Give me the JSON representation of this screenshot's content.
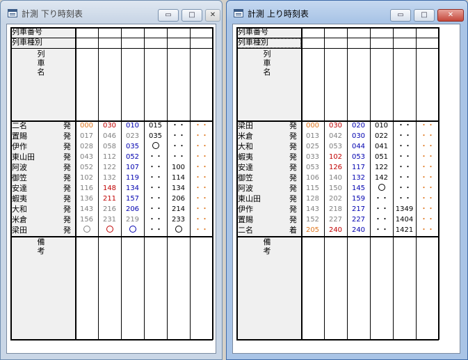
{
  "windows": [
    {
      "id": "down",
      "title": "計測 下り時刻表",
      "controls": {
        "minimize": "▭",
        "maximize": "□",
        "close": "✕"
      },
      "headers": {
        "train_number": "列車番号",
        "train_type": "列車種別",
        "train_name": "列車名",
        "remarks": "備考"
      },
      "stations": [
        {
          "name": "二名",
          "kind": "発"
        },
        {
          "name": "置賜",
          "kind": "発"
        },
        {
          "name": "伊作",
          "kind": "発"
        },
        {
          "name": "東山田",
          "kind": "発"
        },
        {
          "name": "阿波",
          "kind": "発"
        },
        {
          "name": "御笠",
          "kind": "発"
        },
        {
          "name": "安達",
          "kind": "発"
        },
        {
          "name": "蝦夷",
          "kind": "発"
        },
        {
          "name": "大和",
          "kind": "発"
        },
        {
          "name": "米倉",
          "kind": "発"
        },
        {
          "name": "梁田",
          "kind": "発"
        }
      ],
      "columns": [
        {
          "color": "#808080",
          "times": [
            "000",
            "017",
            "028",
            "043",
            "052",
            "102",
            "116",
            "136",
            "143",
            "156",
            "○"
          ],
          "first_color": "#e07820"
        },
        {
          "color": "#808080",
          "times": [
            "030",
            "046",
            "058",
            "112",
            "122",
            "132",
            "148",
            "211",
            "216",
            "231",
            "○"
          ],
          "first_color": "#c00000",
          "red_rows": [
            0,
            6,
            7,
            10
          ]
        },
        {
          "color": "#0000b0",
          "times": [
            "010",
            "023",
            "035",
            "052",
            "107",
            "119",
            "134",
            "157",
            "206",
            "219",
            "○"
          ],
          "gray_rows": [
            1,
            9
          ]
        },
        {
          "color": "#000000",
          "times": [
            "015",
            "035",
            "○",
            "・・",
            "・・",
            "・・",
            "・・",
            "・・",
            "・・",
            "・・",
            "・・"
          ]
        },
        {
          "color": "#000000",
          "times": [
            "・・",
            "・・",
            "・・",
            "・・",
            "100",
            "114",
            "134",
            "206",
            "214",
            "233",
            "○"
          ]
        },
        {
          "color": "#e07820",
          "times": [
            "・・",
            "・・",
            "・・",
            "・・",
            "・・",
            "・・",
            "・・",
            "・・",
            "・・",
            "・・",
            "・・"
          ]
        }
      ]
    },
    {
      "id": "up",
      "title": "計測 上り時刻表",
      "controls": {
        "minimize": "▭",
        "maximize": "□",
        "close": "✕"
      },
      "headers": {
        "train_number": "列車番号",
        "train_type": "列車種別",
        "train_name": "列車名",
        "remarks": "備考"
      },
      "stations": [
        {
          "name": "梁田",
          "kind": "発"
        },
        {
          "name": "米倉",
          "kind": "発"
        },
        {
          "name": "大和",
          "kind": "発"
        },
        {
          "name": "蝦夷",
          "kind": "発"
        },
        {
          "name": "安達",
          "kind": "発"
        },
        {
          "name": "御笠",
          "kind": "発"
        },
        {
          "name": "阿波",
          "kind": "発"
        },
        {
          "name": "東山田",
          "kind": "発"
        },
        {
          "name": "伊作",
          "kind": "発"
        },
        {
          "name": "置賜",
          "kind": "発"
        },
        {
          "name": "二名",
          "kind": "着"
        }
      ],
      "columns": [
        {
          "color": "#808080",
          "times": [
            "000",
            "013",
            "025",
            "033",
            "053",
            "106",
            "115",
            "128",
            "143",
            "152",
            "205"
          ],
          "first_color": "#e07820",
          "last_color": "#e07820"
        },
        {
          "color": "#808080",
          "times": [
            "030",
            "042",
            "053",
            "102",
            "126",
            "140",
            "150",
            "202",
            "218",
            "227",
            "240"
          ],
          "red_rows": [
            0,
            3,
            4,
            10
          ]
        },
        {
          "color": "#0000b0",
          "times": [
            "020",
            "030",
            "044",
            "053",
            "117",
            "132",
            "145",
            "159",
            "217",
            "227",
            "240"
          ]
        },
        {
          "color": "#000000",
          "times": [
            "010",
            "022",
            "041",
            "051",
            "122",
            "142",
            "○",
            "・・",
            "・・",
            "・・",
            "・・"
          ]
        },
        {
          "color": "#000000",
          "times": [
            "・・",
            "・・",
            "・・",
            "・・",
            "・・",
            "・・",
            "・・",
            "・・",
            "1349",
            "1404",
            "1421"
          ]
        },
        {
          "color": "#e07820",
          "times": [
            "・・",
            "・・",
            "・・",
            "・・",
            "・・",
            "・・",
            "・・",
            "・・",
            "・・",
            "・・",
            "・・"
          ]
        }
      ]
    }
  ]
}
